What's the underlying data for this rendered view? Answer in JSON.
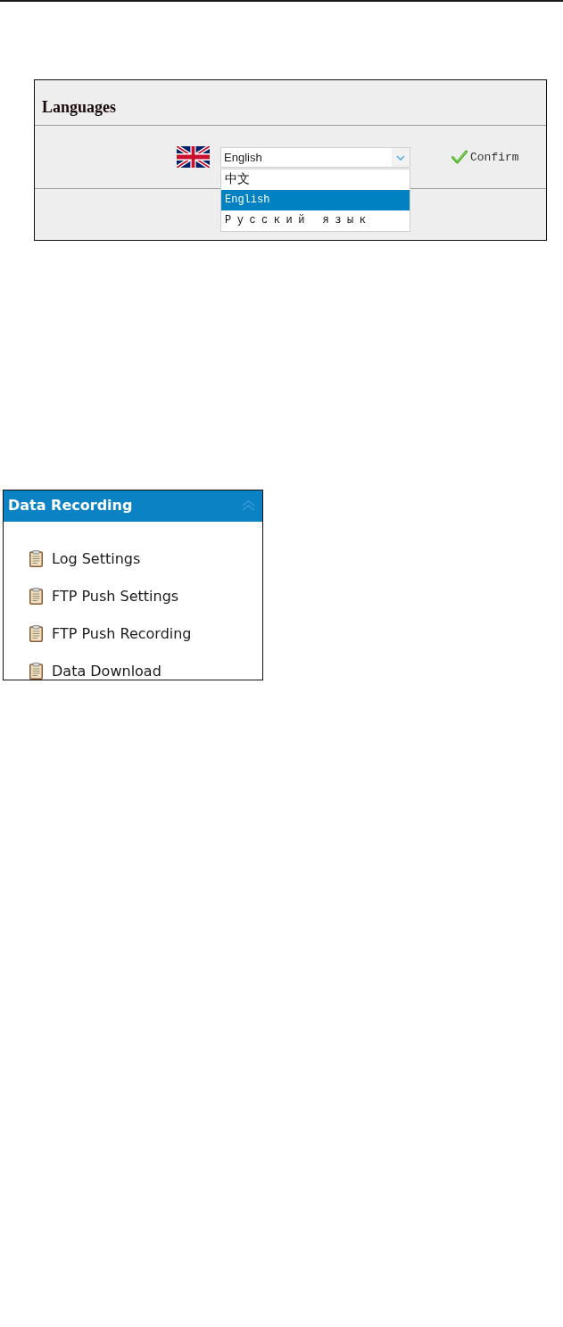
{
  "languages_panel": {
    "title": "Languages",
    "select": {
      "value": "English",
      "expanded": true
    },
    "options": [
      {
        "label": "中文",
        "selected": false
      },
      {
        "label": "English",
        "selected": true
      },
      {
        "label": "Русский язык",
        "selected": false
      }
    ],
    "confirm": "Confirm"
  },
  "data_recording_panel": {
    "title": "Data Recording",
    "expanded": true,
    "items": [
      "Log Settings",
      "FTP Push Settings",
      "FTP Push Recording",
      "Data Download"
    ]
  }
}
